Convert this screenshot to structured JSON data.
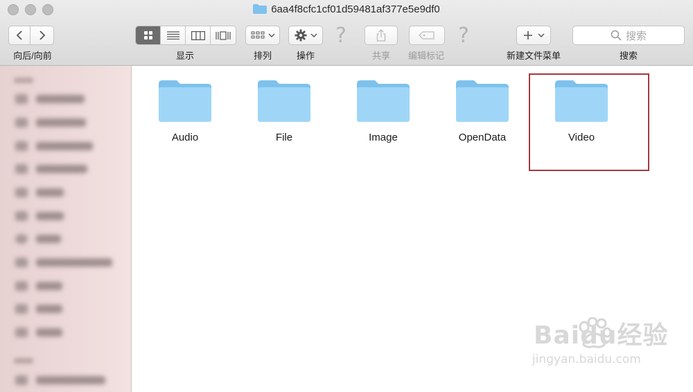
{
  "window": {
    "title": "6aa4f8cfc1cf01d59481af377e5e9df0"
  },
  "toolbar": {
    "nav_label": "向后/向前",
    "view_label": "显示",
    "arrange_label": "排列",
    "action_label": "操作",
    "share_label": "共享",
    "edit_tags_label": "编辑标记",
    "new_folder_menu_label": "新建文件菜单",
    "search_label": "搜索",
    "search_placeholder": "搜索"
  },
  "folders": [
    {
      "name": "Audio"
    },
    {
      "name": "File"
    },
    {
      "name": "Image"
    },
    {
      "name": "OpenData"
    },
    {
      "name": "Video",
      "selected": true
    }
  ],
  "watermark": {
    "brand": "Baidu经验",
    "url": "jingyan.baidu.com"
  },
  "colors": {
    "folder": "#8ecdf4",
    "folder_tab": "#a7dbf8",
    "selection_border": "#a23a3f",
    "sidebar_bg": "#eedada"
  }
}
